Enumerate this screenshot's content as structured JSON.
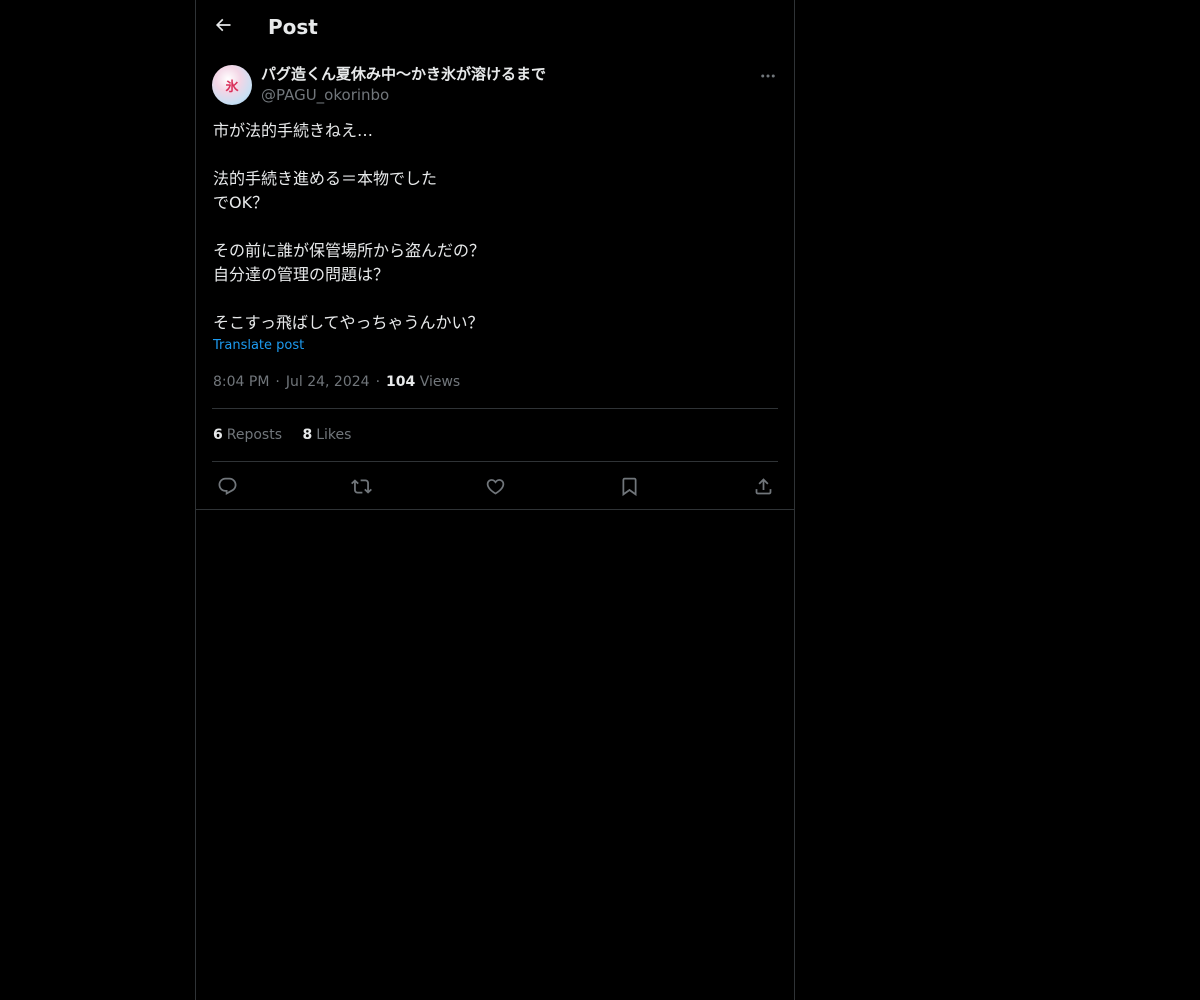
{
  "header": {
    "title": "Post",
    "back_icon": "arrow-left-icon"
  },
  "post": {
    "author": {
      "display_name": "パグ造くん夏休み中〜かき氷が溶けるまで",
      "handle": "@PAGU_okorinbo",
      "avatar_glyph": "氷"
    },
    "text_lines": [
      "市が法的手続きねえ…",
      "",
      "法的手続き進める＝本物でした",
      "でOK？",
      "",
      "その前に誰が保管場所から盗んだの？",
      "自分達の管理の問題は？",
      "",
      "そこすっ飛ばしてやっちゃうんかい？"
    ],
    "translate_label": "Translate post",
    "time": "8:04 PM",
    "date": "Jul 24, 2024",
    "separator": "·",
    "views_count": "104",
    "views_label": "Views",
    "reposts_count": "6",
    "reposts_label": "Reposts",
    "likes_count": "8",
    "likes_label": "Likes"
  },
  "actions": [
    "reply-icon",
    "repost-icon",
    "like-icon",
    "bookmark-icon",
    "share-icon"
  ],
  "colors": {
    "background": "#000000",
    "text": "#e7e9ea",
    "muted": "#71767b",
    "link": "#1d9bf0",
    "border": "#2f3336"
  }
}
